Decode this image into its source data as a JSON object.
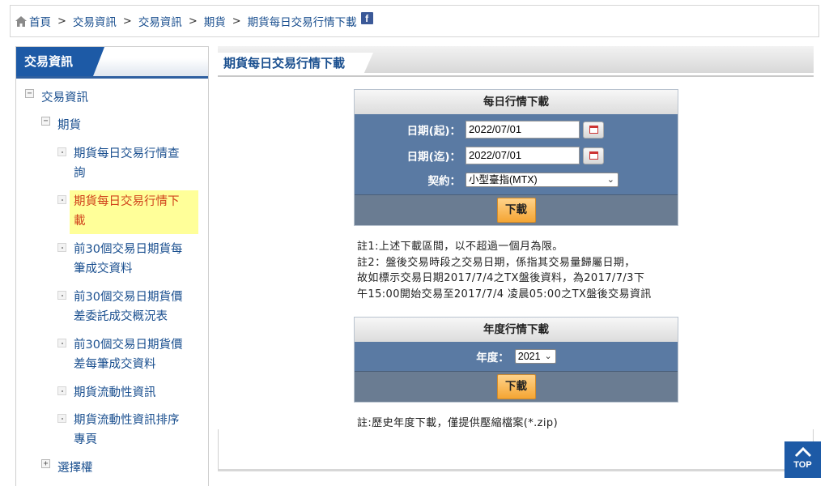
{
  "breadcrumb": {
    "items": [
      "首頁",
      "交易資訊",
      "交易資訊",
      "期貨",
      "期貨每日交易行情下載"
    ],
    "separator": ">"
  },
  "sidebar": {
    "title": "交易資訊",
    "items": [
      {
        "label": "交易資訊",
        "toggle": "−"
      },
      {
        "label": "期貨",
        "toggle": "−"
      },
      {
        "label": "期貨每日交易行情查\n詢"
      },
      {
        "label": "期貨每日交易行情下\n載",
        "active": true
      },
      {
        "label": "前30個交易日期貨每\n筆成交資料"
      },
      {
        "label": "前30個交易日期貨價\n差委託成交概況表"
      },
      {
        "label": "前30個交易日期貨價\n差每筆成交資料"
      },
      {
        "label": "期貨流動性資訊"
      },
      {
        "label": "期貨流動性資訊排序\n專頁"
      },
      {
        "label": "選擇權",
        "toggle": "+"
      }
    ]
  },
  "main": {
    "title": "期貨每日交易行情下載"
  },
  "daily": {
    "title": "每日行情下載",
    "start_label": "日期(起)：",
    "start_value": "2022/07/01",
    "end_label": "日期(迄)：",
    "end_value": "2022/07/01",
    "contract_label": "契約：",
    "contract_value": "小型臺指(MTX)",
    "download": "下載"
  },
  "notes": {
    "line1": "註1:上述下載區間，以不超過一個月為限。",
    "line2": "註2：盤後交易時段之交易日期，係指其交易量歸屬日期，",
    "line3": "故如標示交易日期2017/7/4之TX盤後資料，為2017/7/3下",
    "line4": "午15:00開始交易至2017/7/4 凌晨05:00之TX盤後交易資訊"
  },
  "yearly": {
    "title": "年度行情下載",
    "year_label": "年度：",
    "year_value": "2021",
    "download": "下載",
    "note": "註:歷史年度下載，僅提供壓縮檔案(*.zip)"
  },
  "top_button": "TOP",
  "colors": {
    "brand_blue": "#1d5aa6",
    "form_blue": "#5a7aa3",
    "link_blue": "#1a4f8f",
    "active_red": "#d0421b",
    "highlight_yellow": "#ffff99",
    "button_orange": "#f4a533"
  }
}
